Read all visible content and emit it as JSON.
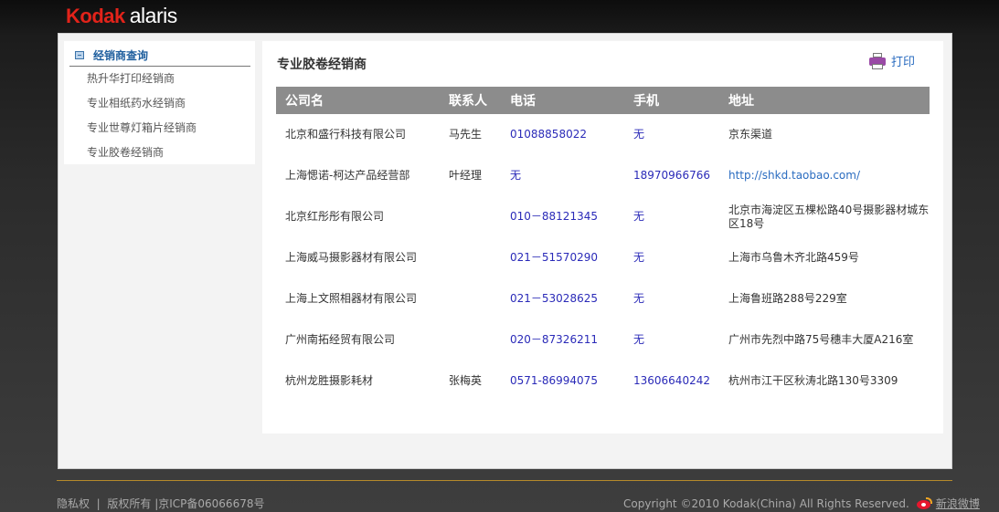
{
  "header": {
    "brand": "Kodak",
    "brand_sub": "alaris"
  },
  "sidebar": {
    "title": "经销商查询",
    "items": [
      {
        "label": "热升华打印经销商"
      },
      {
        "label": "专业相纸药水经销商"
      },
      {
        "label": "专业世尊灯箱片经销商"
      },
      {
        "label": "专业胶卷经销商"
      }
    ]
  },
  "main": {
    "title": "专业胶卷经销商",
    "print_label": "打印",
    "columns": [
      "公司名",
      "联系人",
      "电话",
      "手机",
      "地址"
    ],
    "rows": [
      {
        "company": "北京和盛行科技有限公司",
        "contact": "马先生",
        "phone": "01088858022",
        "mobile": "无",
        "address": "京东渠道"
      },
      {
        "company": "上海愢诺-柯达产品经营部",
        "contact": "叶经理",
        "phone": "无",
        "mobile": "18970966766",
        "address": "http://shkd.taobao.com/"
      },
      {
        "company": "北京红彤彤有限公司",
        "contact": "",
        "phone": "010－88121345",
        "mobile": "无",
        "address": "北京市海淀区五棵松路40号摄影器材城东区18号"
      },
      {
        "company": "上海威马摄影器材有限公司",
        "contact": "",
        "phone": "021－51570290",
        "mobile": "无",
        "address": "上海市乌鲁木齐北路459号"
      },
      {
        "company": "上海上文照相器材有限公司",
        "contact": "",
        "phone": "021－53028625",
        "mobile": "无",
        "address": "上海鲁班路288号229室"
      },
      {
        "company": "广州南拓经贸有限公司",
        "contact": "",
        "phone": "020－87326211",
        "mobile": "无",
        "address": "广州市先烈中路75号穗丰大厦A216室"
      },
      {
        "company": "杭州龙胜摄影耗材",
        "contact": "张梅英",
        "phone": "0571-86994075",
        "mobile": "13606640242",
        "address": "杭州市江干区秋涛北路130号3309"
      }
    ]
  },
  "footer": {
    "privacy": "隐私权",
    "sep1": "|",
    "copyright_link": "版权所有",
    "sep2": "|",
    "icp": "京ICP备06066678号",
    "copyright": "Copyright ©2010 Kodak(China) All Rights Reserved.",
    "weibo": "新浪微博"
  },
  "icons": {
    "sidebar_icon": "list-icon",
    "print_icon": "printer-icon",
    "weibo_icon": "weibo-icon"
  },
  "colors": {
    "brand_red": "#e2231a",
    "link_blue": "#2a6cc0",
    "header_gray": "#8c8c8c",
    "footer_gold": "#b58a2a"
  }
}
